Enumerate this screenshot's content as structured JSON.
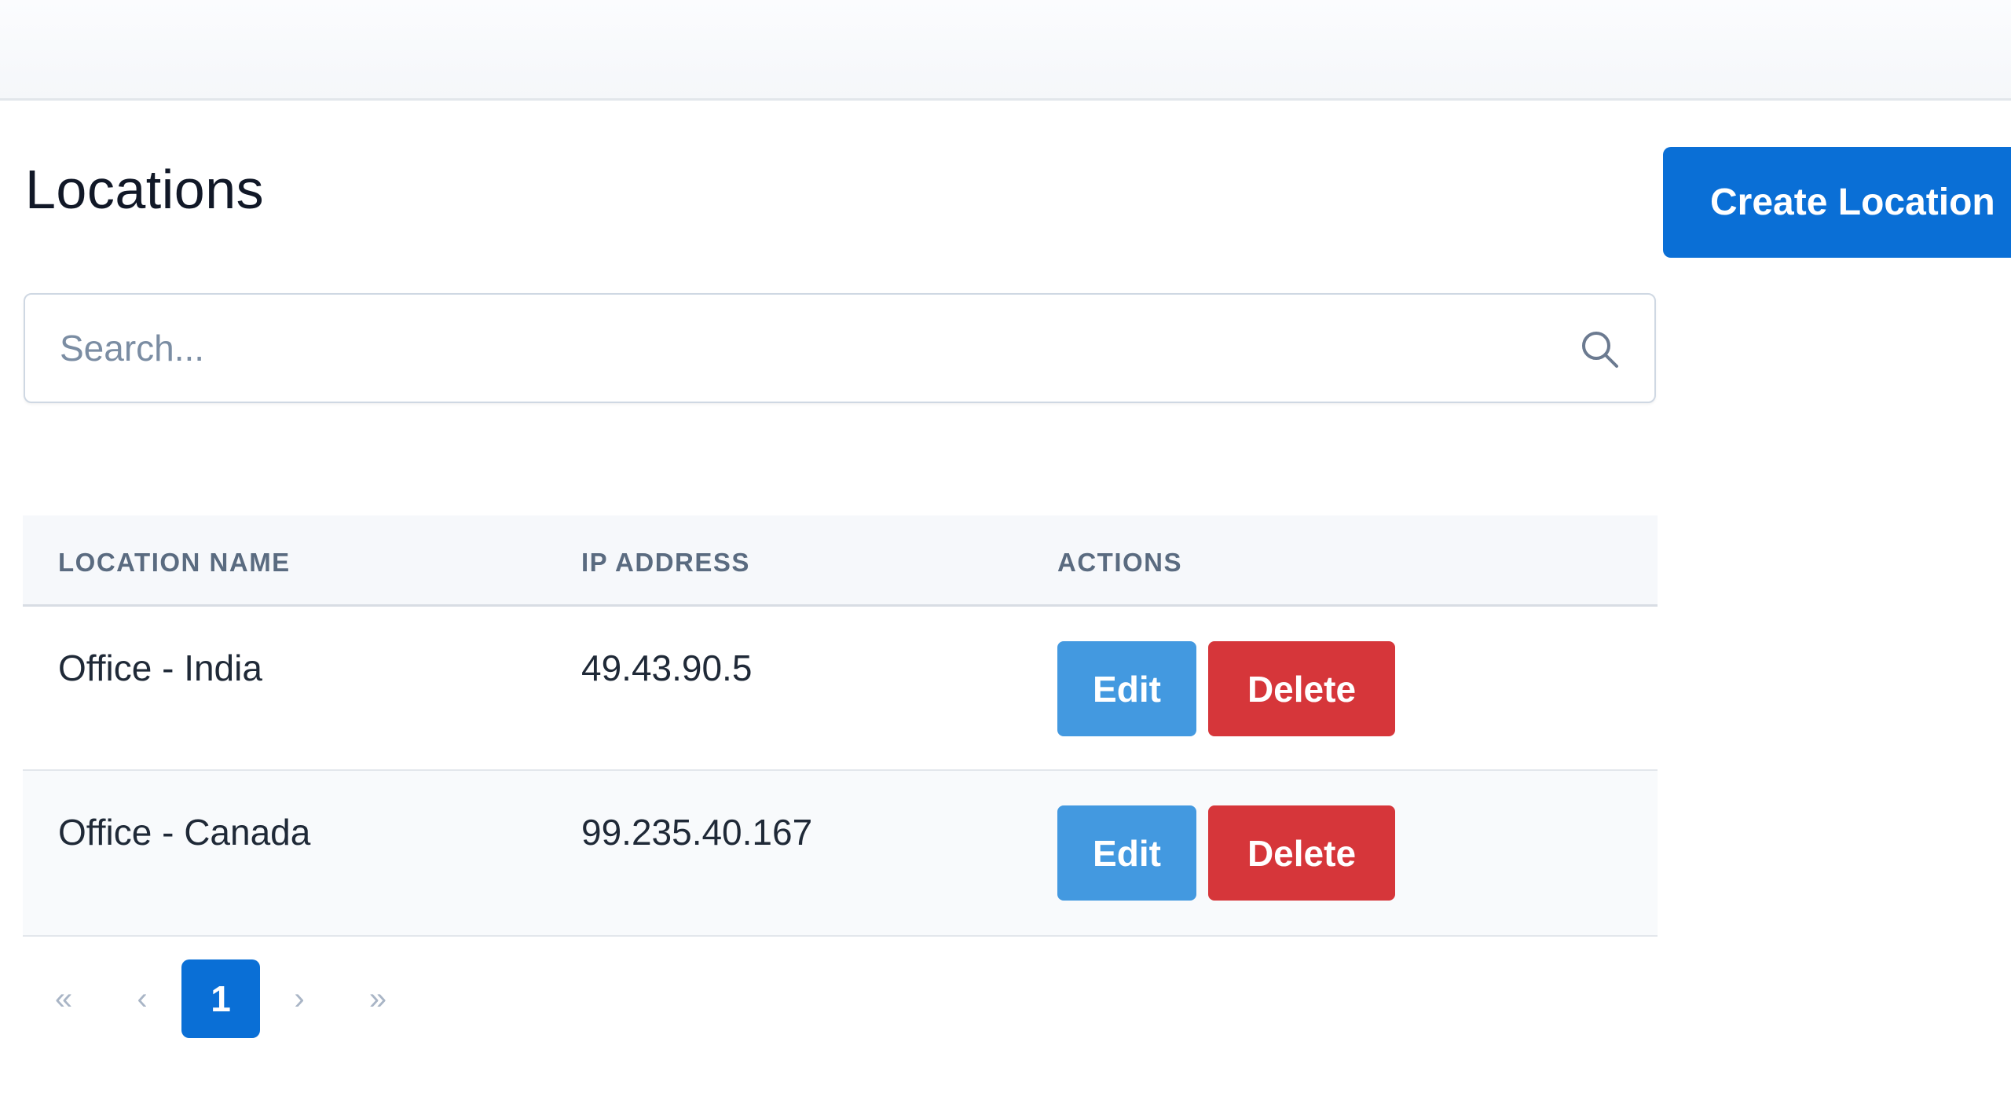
{
  "page": {
    "title": "Locations",
    "create_button_label": "Create Location"
  },
  "search": {
    "placeholder": "Search...",
    "value": "",
    "icon": "search-icon"
  },
  "table": {
    "columns": [
      "LOCATION NAME",
      "IP ADDRESS",
      "ACTIONS"
    ],
    "rows": [
      {
        "name": "Office - India",
        "ip": "49.43.90.5",
        "edit_label": "Edit",
        "delete_label": "Delete"
      },
      {
        "name": "Office - Canada",
        "ip": "99.235.40.167",
        "edit_label": "Edit",
        "delete_label": "Delete"
      }
    ]
  },
  "pagination": {
    "first": "«",
    "prev": "‹",
    "current_page": "1",
    "next": "›",
    "last": "»"
  },
  "colors": {
    "primary": "#0a6fd6",
    "edit": "#4399e0",
    "delete": "#d6363a"
  }
}
